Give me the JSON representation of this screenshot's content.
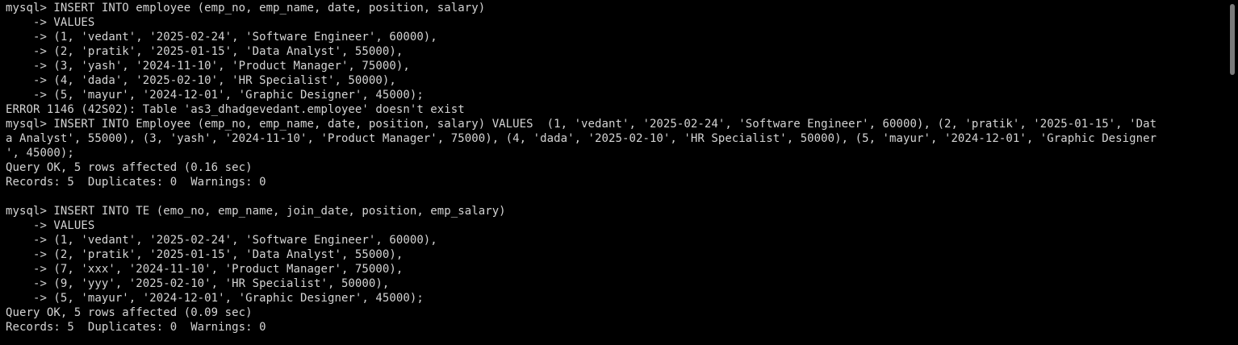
{
  "terminal": {
    "lines": [
      "mysql> INSERT INTO employee (emp_no, emp_name, date, position, salary)",
      "    -> VALUES",
      "    -> (1, 'vedant', '2025-02-24', 'Software Engineer', 60000),",
      "    -> (2, 'pratik', '2025-01-15', 'Data Analyst', 55000),",
      "    -> (3, 'yash', '2024-11-10', 'Product Manager', 75000),",
      "    -> (4, 'dada', '2025-02-10', 'HR Specialist', 50000),",
      "    -> (5, 'mayur', '2024-12-01', 'Graphic Designer', 45000);",
      "ERROR 1146 (42S02): Table 'as3_dhadgevedant.employee' doesn't exist",
      "mysql> INSERT INTO Employee (emp_no, emp_name, date, position, salary) VALUES  (1, 'vedant', '2025-02-24', 'Software Engineer', 60000), (2, 'pratik', '2025-01-15', 'Dat",
      "a Analyst', 55000), (3, 'yash', '2024-11-10', 'Product Manager', 75000), (4, 'dada', '2025-02-10', 'HR Specialist', 50000), (5, 'mayur', '2024-12-01', 'Graphic Designer",
      "', 45000);",
      "Query OK, 5 rows affected (0.16 sec)",
      "Records: 5  Duplicates: 0  Warnings: 0",
      "",
      "mysql> INSERT INTO TE (emo_no, emp_name, join_date, position, emp_salary)",
      "    -> VALUES",
      "    -> (1, 'vedant', '2025-02-24', 'Software Engineer', 60000),",
      "    -> (2, 'pratik', '2025-01-15', 'Data Analyst', 55000),",
      "    -> (7, 'xxx', '2024-11-10', 'Product Manager', 75000),",
      "    -> (9, 'yyy', '2025-02-10', 'HR Specialist', 50000),",
      "    -> (5, 'mayur', '2024-12-01', 'Graphic Designer', 45000);",
      "Query OK, 5 rows affected (0.09 sec)",
      "Records: 5  Duplicates: 0  Warnings: 0"
    ]
  }
}
